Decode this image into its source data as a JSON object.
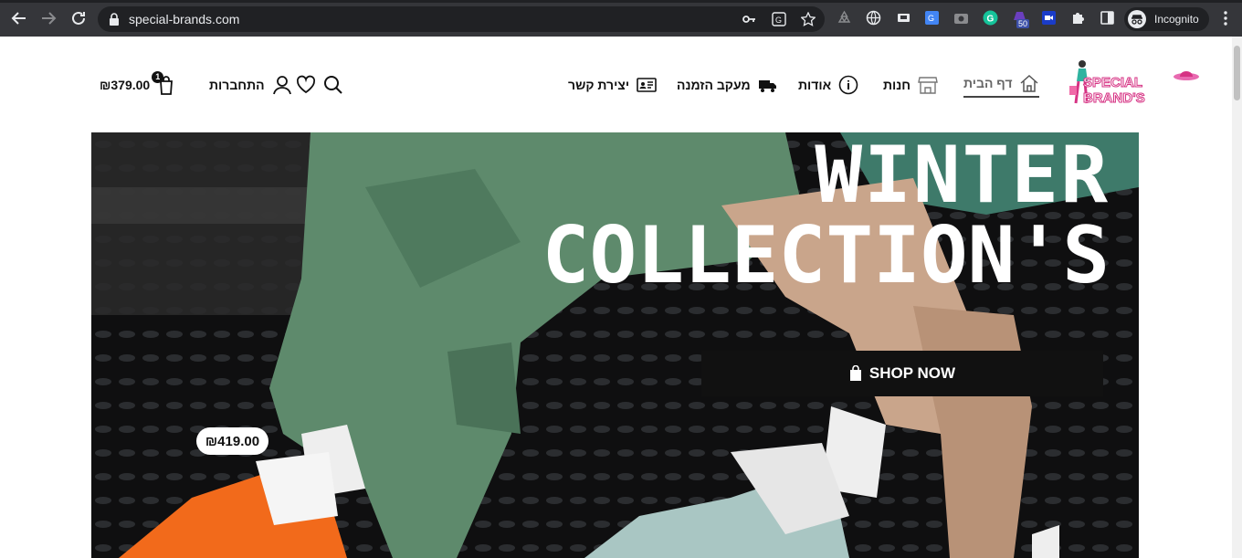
{
  "browser": {
    "url": "special-brands.com",
    "profile_label": "Incognito",
    "extension_badge": "50"
  },
  "header": {
    "logo_text": "SPECIAL BRAND'S",
    "nav": {
      "home": "דף הבית",
      "shop": "חנות",
      "about": "אודות",
      "track_order": "מעקב הזמנה",
      "contact": "יצירת קשר"
    },
    "login_label": "התחברות",
    "cart_total": "₪379.00",
    "cart_count": "1"
  },
  "hero": {
    "title_line1": "WINTER",
    "title_line2": "COLLECTION'S",
    "cta_label": "SHOP NOW",
    "price_tag": "₪419.00"
  },
  "colors": {
    "chrome_bg": "#35363a",
    "omnibox_bg": "#202124",
    "hero_bg": "#141414",
    "accent": "#d63384"
  }
}
